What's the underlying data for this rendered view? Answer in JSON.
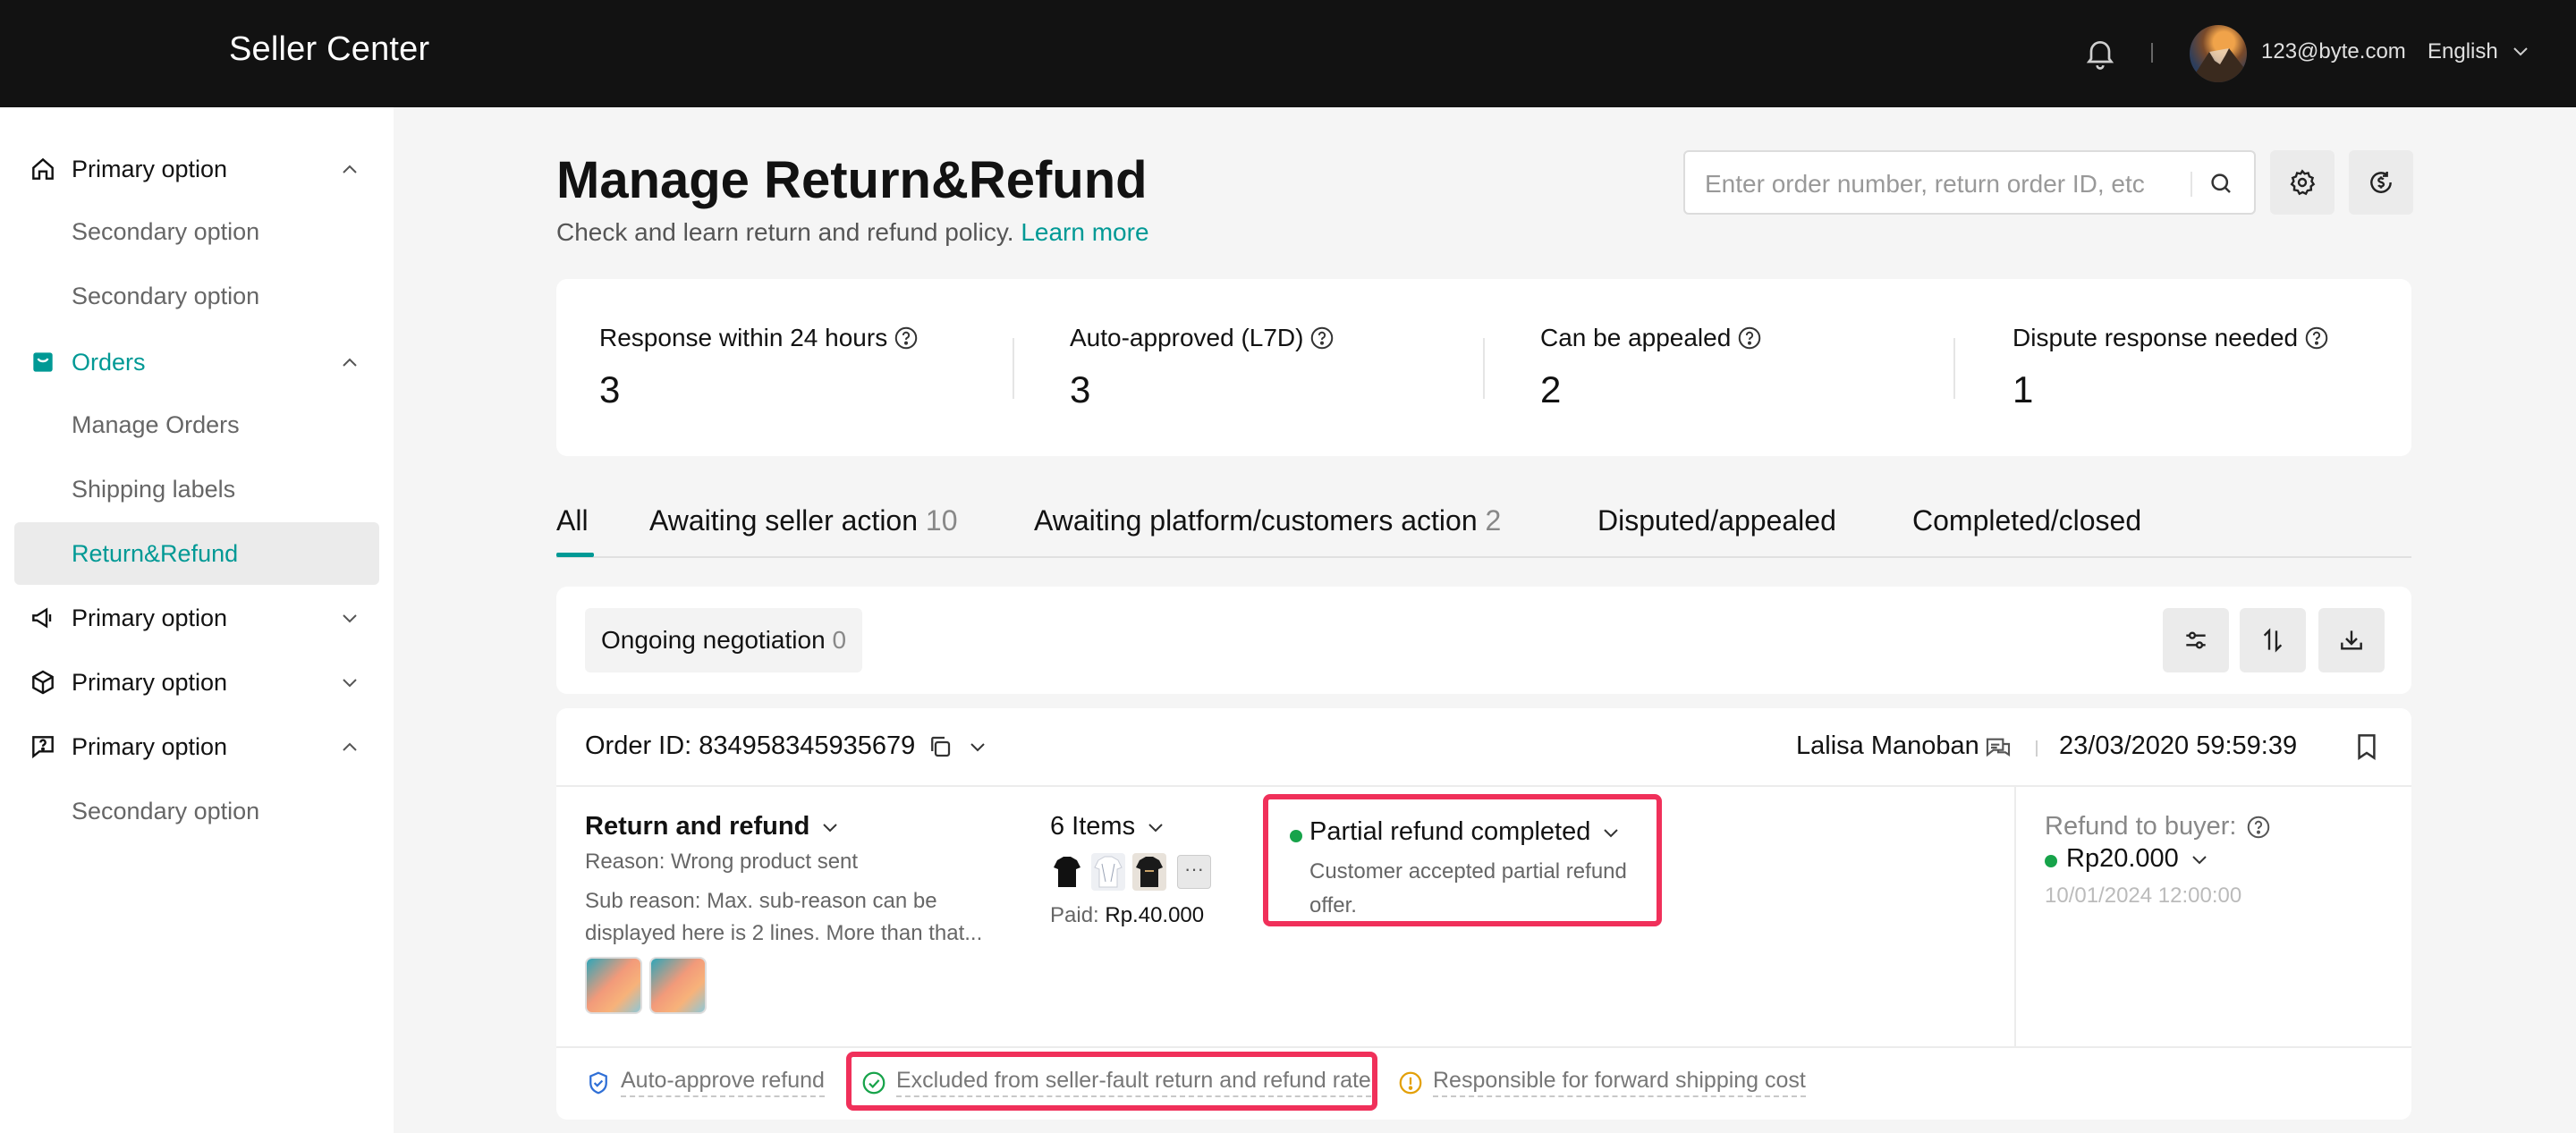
{
  "header": {
    "brand": "Seller Center",
    "email": "123@byte.com",
    "language": "English",
    "separator": "|"
  },
  "sidebar": {
    "items": [
      {
        "label": "Primary option",
        "icon": "home-icon",
        "type": "group",
        "expanded": true
      },
      {
        "label": "Secondary option",
        "type": "sub"
      },
      {
        "label": "Secondary option",
        "type": "sub"
      },
      {
        "label": "Orders",
        "icon": "orders-icon",
        "type": "group",
        "expanded": true,
        "active": true
      },
      {
        "label": "Manage Orders",
        "type": "sub"
      },
      {
        "label": "Shipping labels",
        "type": "sub"
      },
      {
        "label": "Return&Refund",
        "type": "sub",
        "selected": true
      },
      {
        "label": "Primary option",
        "icon": "megaphone-icon",
        "type": "group",
        "expanded": false
      },
      {
        "label": "Primary option",
        "icon": "cube-icon",
        "type": "group",
        "expanded": false
      },
      {
        "label": "Primary option",
        "icon": "help-chat-icon",
        "type": "group",
        "expanded": true
      },
      {
        "label": "Secondary option",
        "type": "sub"
      }
    ]
  },
  "page": {
    "title": "Manage Return&Refund",
    "subtitle": "Check and learn return and refund policy.",
    "learn_more": "Learn more",
    "search_placeholder": "Enter order number, return order ID, etc"
  },
  "stats": [
    {
      "label": "Response within 24 hours",
      "value": "3"
    },
    {
      "label": "Auto-approved (L7D)",
      "value": "3"
    },
    {
      "label": "Can be appealed",
      "value": "2"
    },
    {
      "label": "Dispute response needed",
      "value": "1"
    }
  ],
  "tabs": [
    {
      "label": "All",
      "count": "",
      "active": true
    },
    {
      "label": "Awaiting seller action",
      "count": "10"
    },
    {
      "label": "Awaiting platform/customers action",
      "count": "2"
    },
    {
      "label": "Disputed/appealed",
      "count": ""
    },
    {
      "label": "Completed/closed",
      "count": ""
    }
  ],
  "filter": {
    "chip_label": "Ongoing negotiation",
    "chip_count": "0"
  },
  "order": {
    "id_label": "Order ID: 834958345935679",
    "buyer": "Lalisa Manoban",
    "date": "23/03/2020 59:59:39",
    "type": "Return and refund",
    "reason": "Reason: Wrong product sent",
    "sub_reason": "Sub reason: Max. sub-reason can be displayed here is 2 lines. More than that...",
    "items": "6 Items",
    "more_items": "···",
    "paid_label": "Paid:",
    "paid_value": "Rp.40.000",
    "status": "Partial refund completed",
    "status_desc": "Customer accepted partial refund offer.",
    "status_color": "#17a34a",
    "refund_label": "Refund to buyer:",
    "refund_amount": "Rp20.000",
    "refund_date": "10/01/2024 12:00:00",
    "flags": [
      "Auto-approve refund",
      "Excluded from seller-fault return and refund rate",
      "Responsible for forward shipping cost"
    ]
  },
  "colors": {
    "accent": "#009995",
    "highlight": "#f0305a",
    "topbar": "#121212",
    "success": "#17a34a",
    "warning": "#e3a008"
  }
}
